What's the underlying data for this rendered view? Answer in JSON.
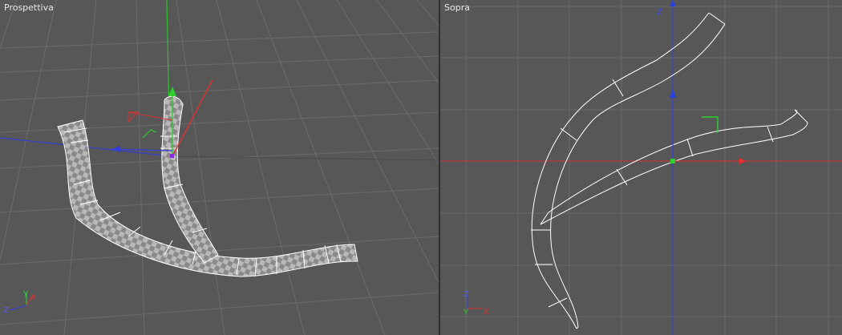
{
  "viewports": {
    "left": {
      "title": "Prospettiva",
      "axis_labels": {
        "y": "Y",
        "z": "Z",
        "x": "X"
      }
    },
    "right": {
      "title": "Sopra",
      "axis_labels": {
        "z_top": "Z",
        "y": "Y",
        "x": "X"
      }
    }
  },
  "colors": {
    "viewport_bg": "#575757",
    "grid": "#686868",
    "x_axis": "#e03030",
    "y_axis": "#30d030",
    "z_axis": "#3040e0",
    "wire": "#ffffff"
  }
}
